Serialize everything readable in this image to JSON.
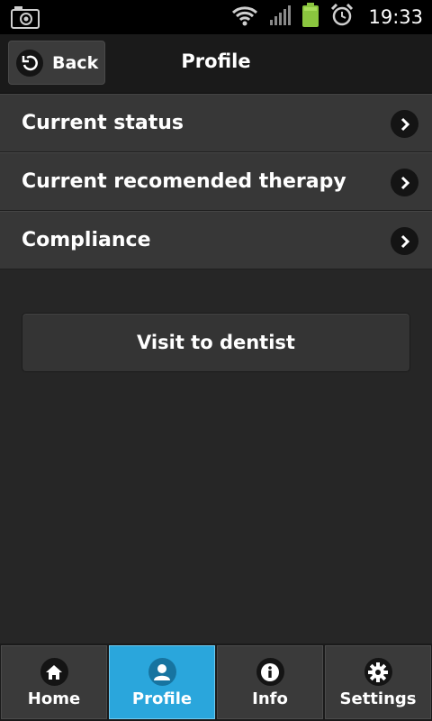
{
  "status_bar": {
    "time": "19:33",
    "icons": [
      "camera-icon",
      "wifi-icon",
      "signal-icon",
      "battery-icon",
      "alarm-icon"
    ]
  },
  "header": {
    "back_label": "Back",
    "title": "Profile"
  },
  "menu": {
    "items": [
      {
        "label": "Current status"
      },
      {
        "label": "Current recomended therapy"
      },
      {
        "label": "Compliance"
      }
    ]
  },
  "actions": {
    "visit_label": "Visit to dentist"
  },
  "tabs": [
    {
      "label": "Home",
      "icon": "home-icon",
      "active": false
    },
    {
      "label": "Profile",
      "icon": "user-icon",
      "active": true
    },
    {
      "label": "Info",
      "icon": "info-icon",
      "active": false
    },
    {
      "label": "Settings",
      "icon": "gear-icon",
      "active": false
    }
  ],
  "colors": {
    "accent": "#2aa6dc",
    "battery": "#8bc63f",
    "background": "#262626"
  }
}
